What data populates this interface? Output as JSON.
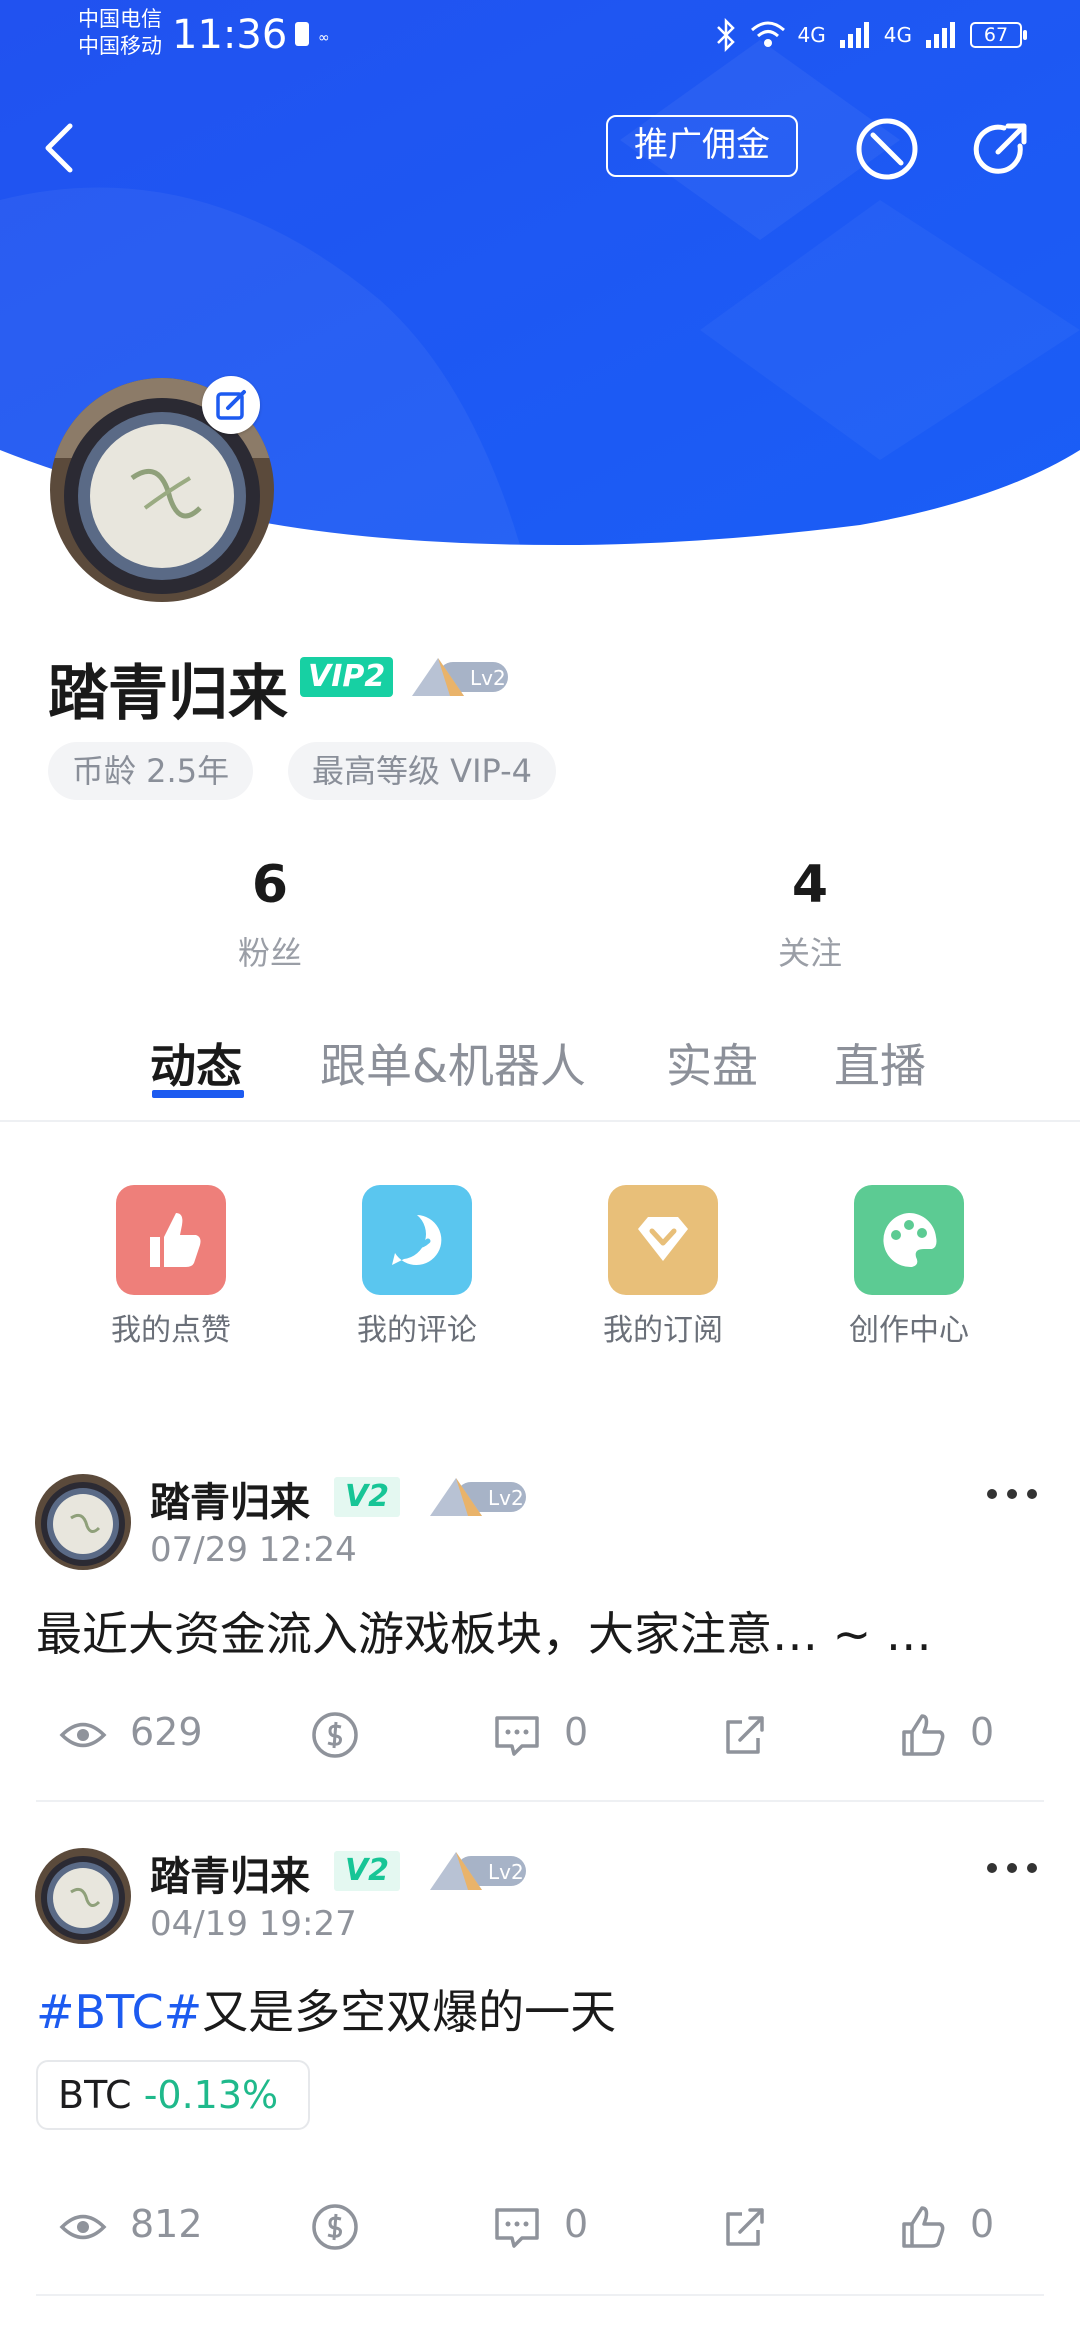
{
  "status_bar": {
    "carrier1": "中国电信",
    "carrier2": "中国移动",
    "time": "11:36",
    "net1": "4G",
    "net2": "4G",
    "battery": "67"
  },
  "header": {
    "promo_label": "推广佣金",
    "accent": "#1f57f2"
  },
  "profile": {
    "name": "踏青归来",
    "vip": "VIP2",
    "level": "Lv2",
    "coin_age": "币龄 2.5年",
    "max_level": "最高等级 VIP-4",
    "followers_count": "6",
    "followers_label": "粉丝",
    "following_count": "4",
    "following_label": "关注"
  },
  "tabs": [
    {
      "label": "动态",
      "active": true
    },
    {
      "label": "跟单&机器人"
    },
    {
      "label": "实盘"
    },
    {
      "label": "直播"
    }
  ],
  "quick_actions": [
    {
      "label": "我的点赞",
      "icon": "thumbs-up-icon",
      "color": "#ee7f7a"
    },
    {
      "label": "我的评论",
      "icon": "chat-bubble-icon",
      "color": "#5ac6ef"
    },
    {
      "label": "我的订阅",
      "icon": "diamond-icon",
      "color": "#e8bf79"
    },
    {
      "label": "创作中心",
      "icon": "palette-icon",
      "color": "#5ccb93"
    }
  ],
  "posts": [
    {
      "author": "踏青归来",
      "vip": "V2",
      "level": "Lv2",
      "time": "07/29 12:24",
      "text": "最近大资金流入游戏板块，大家注意… ~ …",
      "views": "629",
      "comments": "0",
      "likes": "0"
    },
    {
      "author": "踏青归来",
      "vip": "V2",
      "level": "Lv2",
      "time": "04/19 19:27",
      "hashtag": "#BTC#",
      "text": "又是多空双爆的一天",
      "coin": "BTC",
      "coin_change": "-0.13%",
      "views": "812",
      "comments": "0",
      "likes": "0"
    }
  ]
}
